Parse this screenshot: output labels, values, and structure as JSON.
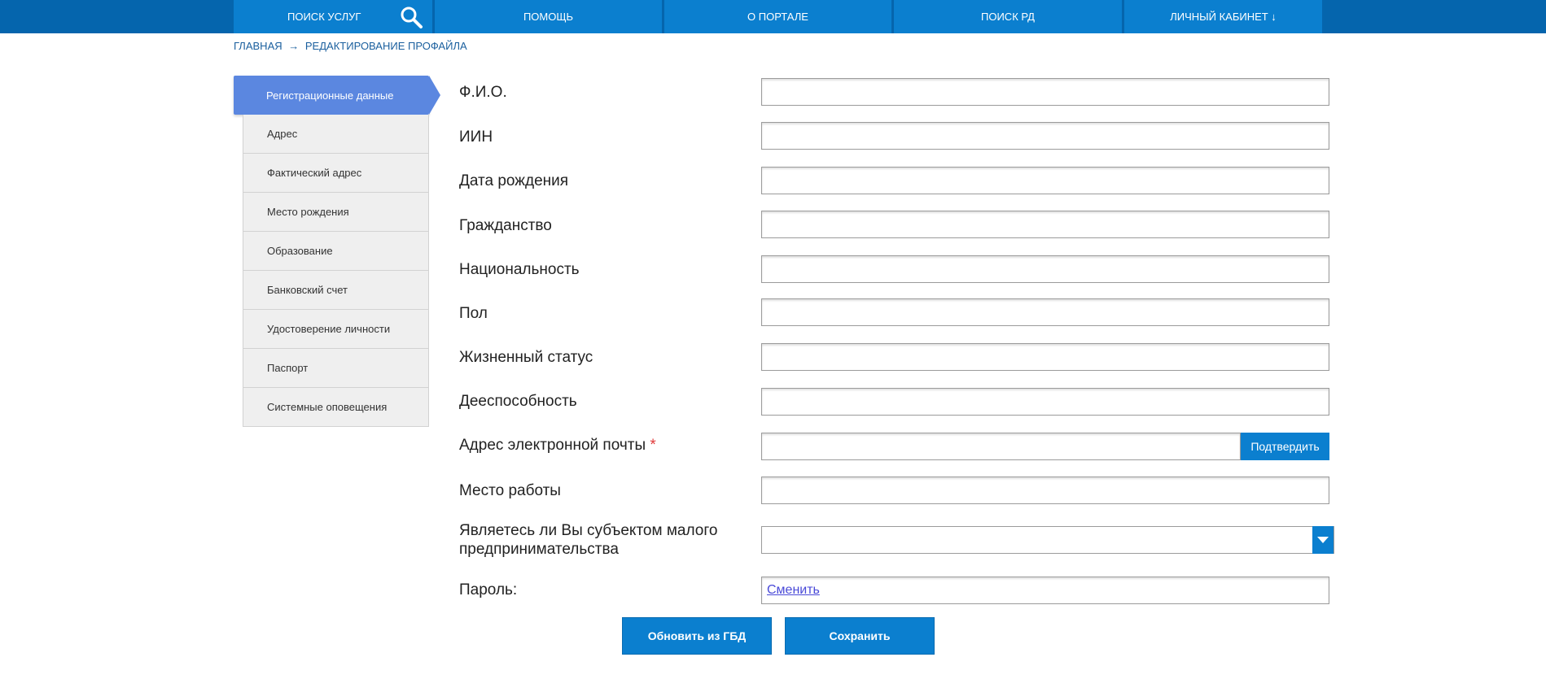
{
  "nav": {
    "items": [
      {
        "label": "Поиск услуг"
      },
      {
        "label": "Помощь"
      },
      {
        "label": "О портале"
      },
      {
        "label": "Поиск РД"
      },
      {
        "label": "Личный кабинет ↓"
      }
    ]
  },
  "breadcrumb": {
    "home": "Главная",
    "separator": "→",
    "current": "Редактирование профайла"
  },
  "sidebar": {
    "items": [
      {
        "label": "Регистрационные данные",
        "active": true
      },
      {
        "label": "Адрес"
      },
      {
        "label": "Фактический адрес"
      },
      {
        "label": "Место рождения"
      },
      {
        "label": "Образование"
      },
      {
        "label": "Банковский счет"
      },
      {
        "label": "Удостоверение личности"
      },
      {
        "label": "Паспорт"
      },
      {
        "label": "Системные оповещения"
      }
    ]
  },
  "form": {
    "fio_label": "Ф.И.О.",
    "iin_label": "ИИН",
    "birthdate_label": "Дата рождения",
    "citizenship_label": "Гражданство",
    "nationality_label": "Национальность",
    "gender_label": "Пол",
    "life_status_label": "Жизненный статус",
    "capacity_label": "Дееспособность",
    "email_label": "Адрес электронной почты",
    "email_required_mark": "*",
    "confirm_label": "Подтвердить",
    "workplace_label": "Место работы",
    "small_business_label_line1": "Являетесь ли Вы субъектом малого",
    "small_business_label_line2": "предпринимательства",
    "password_label": "Пароль:",
    "password_change_link": "Сменить"
  },
  "actions": {
    "update_gbd": "Обновить из ГБД",
    "save": "Сохранить"
  },
  "colors": {
    "nav_bg": "#0565ad",
    "nav_item_bg": "#0b7fcf",
    "sidebar_active": "#5b87e0",
    "button_bg": "#0b7fcf"
  }
}
